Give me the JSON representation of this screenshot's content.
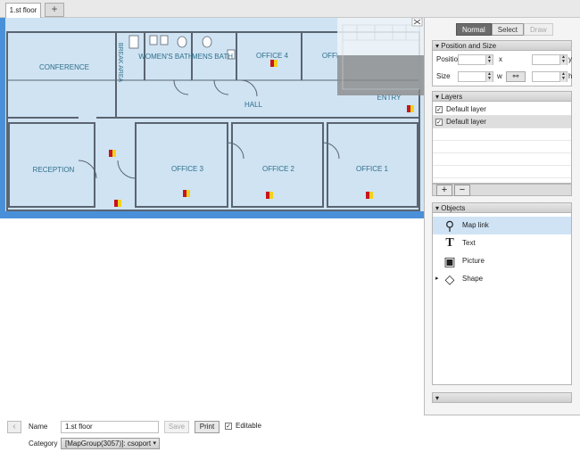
{
  "tabs": [
    {
      "label": "1.st floor"
    }
  ],
  "tab_add_label": "+",
  "floorplan": {
    "rooms": [
      "CONFERENCE",
      "BREAK AREA",
      "WOMEN'S BATH",
      "MENS BATH",
      "OFFICE 4",
      "OFFI",
      "ENTRY",
      "HALL",
      "RECEPTION",
      "OFFICE 3",
      "OFFICE 2",
      "OFFICE 1"
    ]
  },
  "modes": [
    {
      "label": "Normal",
      "state": "active"
    },
    {
      "label": "Select",
      "state": "normal"
    },
    {
      "label": "Draw",
      "state": "disabled"
    }
  ],
  "position_size": {
    "header": "Position and Size",
    "position_label": "Position",
    "size_label": "Size",
    "x_label": "x",
    "y_label": "y",
    "w_label": "w",
    "h_label": "h",
    "link_symbol": "⚯"
  },
  "layers": {
    "header": "Layers",
    "items": [
      {
        "label": "Default layer",
        "checked": "✓"
      },
      {
        "label": "Default layer",
        "checked": "✓"
      }
    ],
    "add_label": "+",
    "remove_label": "−"
  },
  "objects": {
    "header": "Objects",
    "items": [
      {
        "label": "Map link",
        "icon": "map-pin-icon",
        "glyph": "⚲"
      },
      {
        "label": "Text",
        "icon": "text-icon",
        "glyph": "T"
      },
      {
        "label": "Picture",
        "icon": "picture-icon",
        "glyph": "▣"
      },
      {
        "label": "Shape",
        "icon": "shape-icon",
        "glyph": "◇",
        "expander": "▸"
      }
    ]
  },
  "section_arrow": "▾",
  "form": {
    "back_symbol": "‹",
    "name_label": "Name",
    "name_value": "1.st floor",
    "save_label": "Save",
    "print_label": "Print",
    "editable_label": "Editable",
    "editable_check": "✓",
    "category_label": "Category",
    "category_value": "[MapGroup(3057)]: csoport",
    "category_caret": "▾"
  },
  "colors": {
    "canvas_bg": "#4a90d9",
    "room_fill": "#cfe3f3",
    "wall": "#5a6470",
    "room_text": "#2f6f8a",
    "marker_red": "#c8141e",
    "marker_yellow": "#f4d21c"
  }
}
